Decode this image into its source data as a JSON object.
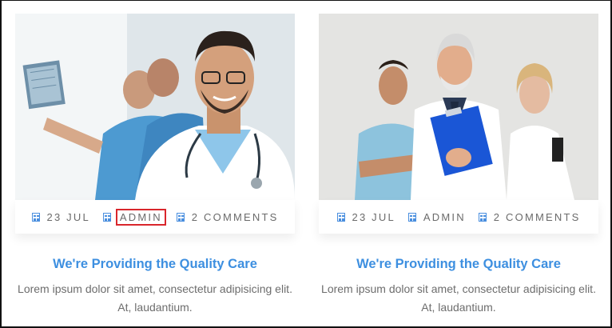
{
  "cards": [
    {
      "date": "23 JUL",
      "author": "ADMIN",
      "comments": "2 COMMENTS",
      "title": "We're Providing the Quality Care",
      "excerpt": "Lorem ipsum dolor sit amet, consectetur adipisicing elit. At, laudantium."
    },
    {
      "date": "23 JUL",
      "author": "ADMIN",
      "comments": "2 COMMENTS",
      "title": "We're Providing the Quality Care",
      "excerpt": "Lorem ipsum dolor sit amet, consectetur adipisicing elit. At, laudantium."
    }
  ],
  "colors": {
    "accent": "#3d8fe0",
    "highlight": "#d9262c"
  },
  "icons": [
    "calendar-icon",
    "user-icon",
    "comment-icon"
  ]
}
